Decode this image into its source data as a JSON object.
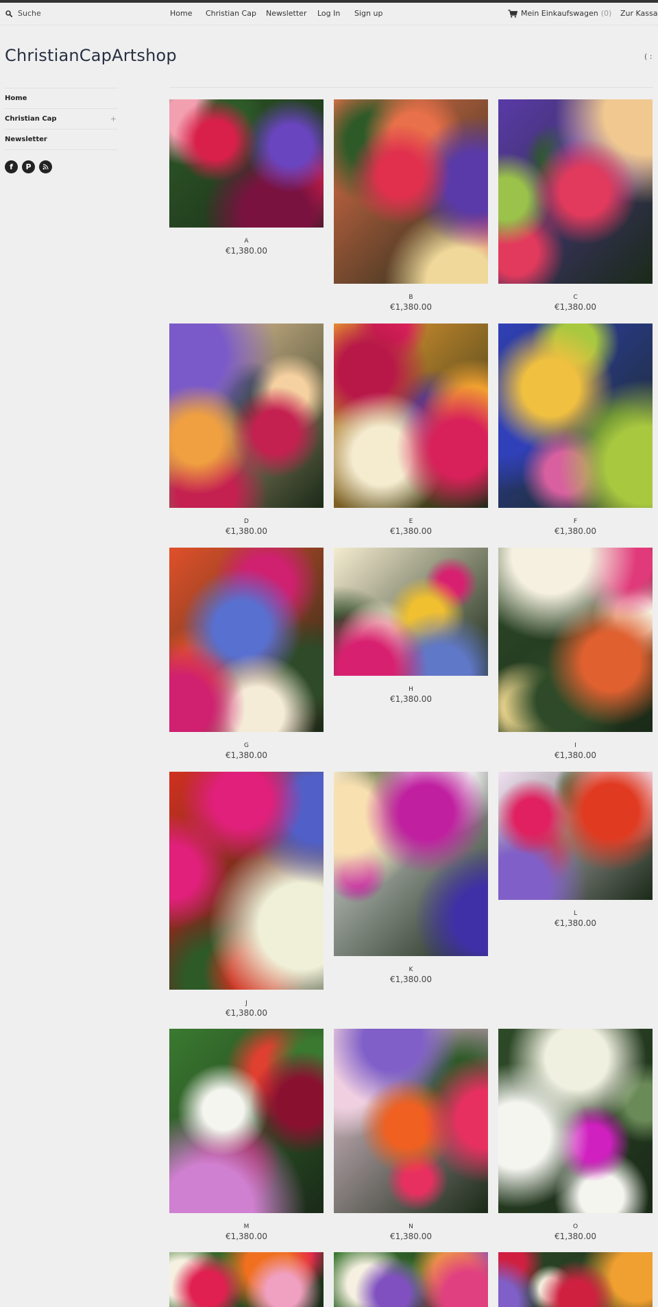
{
  "search": {
    "placeholder": "Suche"
  },
  "nav": {
    "items": [
      {
        "label": "Home"
      },
      {
        "label": "Christian Cap"
      },
      {
        "label": "Newsletter"
      },
      {
        "label": "Log In"
      },
      {
        "label": "Sign up"
      }
    ]
  },
  "cart": {
    "label": "Mein Einkaufswagen",
    "count": "(0)"
  },
  "checkout_label": "Zur Kassa",
  "shop_title": "ChristianCapArtshop",
  "smiley": "( :",
  "sidebar": {
    "items": [
      {
        "label": "Home"
      },
      {
        "label": "Christian Cap",
        "expander": "+"
      },
      {
        "label": "Newsletter"
      }
    ],
    "social": {
      "facebook": "f",
      "pinterest": "P",
      "rss": "rss"
    }
  },
  "products": [
    {
      "name": "A",
      "price": "€1,380.00",
      "colors": [
        "#d8204a",
        "#6a45c0",
        "#7a1240",
        "#2e5a28",
        "#f2a0b0"
      ]
    },
    {
      "name": "B",
      "price": "€1,380.00",
      "colors": [
        "#e0304e",
        "#5a3aa8",
        "#f0d89a",
        "#e8704a",
        "#2e5a28"
      ]
    },
    {
      "name": "C",
      "price": "€1,380.00",
      "colors": [
        "#e23a5c",
        "#9bc24a",
        "#f0c890",
        "#5a3aa8",
        "#2e5a28"
      ]
    },
    {
      "name": "D",
      "price": "€1,380.00",
      "colors": [
        "#c42050",
        "#f0a040",
        "#7a5ac8",
        "#f5d0a0",
        "#2e4a28"
      ]
    },
    {
      "name": "E",
      "price": "€1,380.00",
      "colors": [
        "#d8205a",
        "#f5ecd0",
        "#b81848",
        "#f0a030",
        "#5a3a88"
      ]
    },
    {
      "name": "F",
      "price": "€1,380.00",
      "colors": [
        "#a8c840",
        "#d860a0",
        "#f0c040",
        "#3040b8",
        "#2e5a28"
      ]
    },
    {
      "name": "G",
      "price": "€1,380.00",
      "colors": [
        "#d02070",
        "#f5ecd8",
        "#5870d0",
        "#e0502a",
        "#2e4a28"
      ]
    },
    {
      "name": "H",
      "price": "€1,380.00",
      "colors": [
        "#d82070",
        "#6078c8",
        "#f0c030",
        "#f5ecd0",
        "#2e4a28"
      ]
    },
    {
      "name": "I",
      "price": "€1,380.00",
      "colors": [
        "#f5f0e0",
        "#e03a7a",
        "#e06030",
        "#2e4a28",
        "#f0d890"
      ]
    },
    {
      "name": "J",
      "price": "€1,380.00",
      "colors": [
        "#e0207a",
        "#5060c8",
        "#f0f0d8",
        "#d03020",
        "#2e5a28"
      ]
    },
    {
      "name": "K",
      "price": "€1,380.00",
      "colors": [
        "#c020a0",
        "#f8e0b0",
        "#4030a8",
        "#f0f0f0",
        "#2e4a28"
      ]
    },
    {
      "name": "L",
      "price": "€1,380.00",
      "colors": [
        "#e03a20",
        "#e02060",
        "#8060c8",
        "#f0e0f0",
        "#2e5a28"
      ]
    },
    {
      "name": "M",
      "price": "€1,380.00",
      "colors": [
        "#8a1030",
        "#f5f5f0",
        "#d080d0",
        "#3a7a30",
        "#e04030"
      ]
    },
    {
      "name": "N",
      "price": "€1,380.00",
      "colors": [
        "#e83060",
        "#f06020",
        "#8060c8",
        "#f0d0e0",
        "#2e5a28"
      ]
    },
    {
      "name": "O",
      "price": "€1,380.00",
      "colors": [
        "#f5f5f0",
        "#d020c0",
        "#f0f0e0",
        "#2e4a28",
        "#6a8a58"
      ]
    },
    {
      "name": "",
      "price": "",
      "colors": [
        "#e02050",
        "#f0a0c0",
        "#f07020",
        "#3a7a30",
        "#f5f0e0"
      ]
    },
    {
      "name": "",
      "price": "",
      "colors": [
        "#8050c0",
        "#e04080",
        "#f0a040",
        "#3a7a30",
        "#f5f0e0"
      ]
    },
    {
      "name": "",
      "price": "",
      "colors": [
        "#d02040",
        "#8060c8",
        "#f0a030",
        "#2e4a28",
        "#f5f0e0"
      ]
    }
  ]
}
